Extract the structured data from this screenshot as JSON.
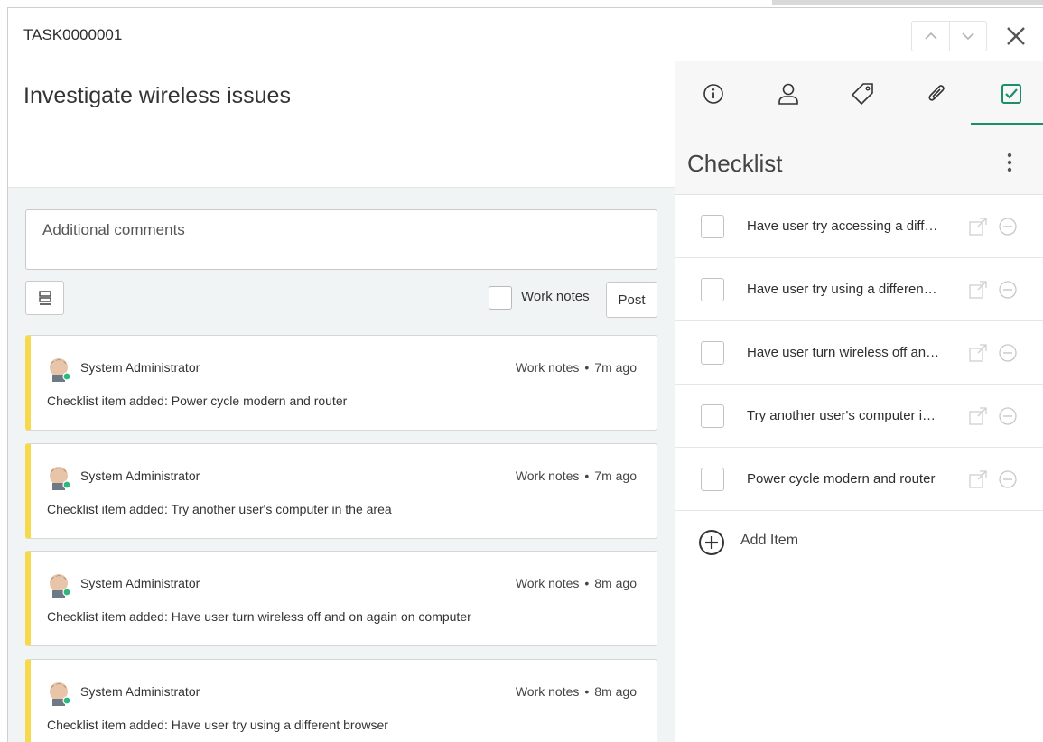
{
  "header": {
    "task_id": "TASK0000001"
  },
  "main": {
    "title": "Investigate wireless issues",
    "comments_placeholder": "Additional comments",
    "work_notes_label": "Work notes",
    "post_label": "Post"
  },
  "activity": [
    {
      "author": "System Administrator",
      "type": "Work notes",
      "time": "7m ago",
      "message": "Checklist item added: Power cycle modern and router"
    },
    {
      "author": "System Administrator",
      "type": "Work notes",
      "time": "7m ago",
      "message": "Checklist item added: Try another user's computer in the area"
    },
    {
      "author": "System Administrator",
      "type": "Work notes",
      "time": "8m ago",
      "message": "Checklist item added: Have user turn wireless off and on again on computer"
    },
    {
      "author": "System Administrator",
      "type": "Work notes",
      "time": "8m ago",
      "message": "Checklist item added: Have user try using a different browser"
    }
  ],
  "tabs": [
    "info-icon",
    "user-icon",
    "tag-icon",
    "paperclip-icon",
    "checklist-icon"
  ],
  "checklist": {
    "title": "Checklist",
    "items": [
      "Have user try accessing a diff…",
      "Have user try using a differen…",
      "Have user turn wireless off an…",
      "Try another user's computer i…",
      "Power cycle modern and router"
    ],
    "add_label": "Add Item"
  },
  "colors": {
    "accent": "#1b8f6c",
    "work_note_stripe": "#f6d94c",
    "activity_bg": "#f0f4f4"
  }
}
